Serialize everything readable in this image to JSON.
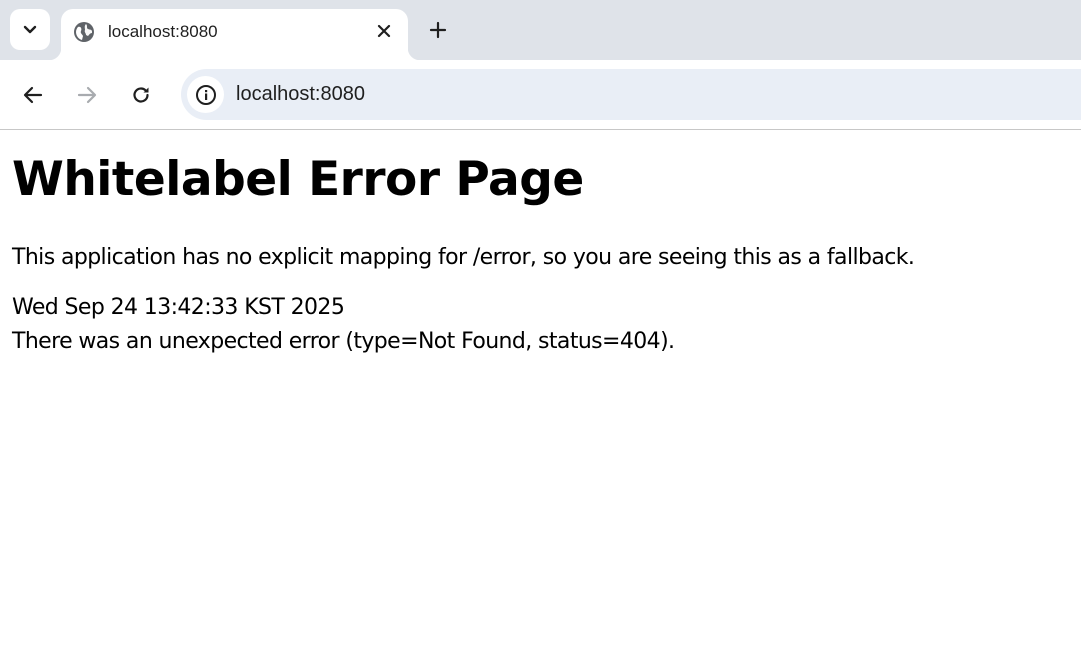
{
  "browser": {
    "tab": {
      "title": "localhost:8080",
      "favicon": "globe-icon"
    },
    "toolbar": {
      "back_icon": "arrow-left-icon",
      "forward_icon": "arrow-right-icon",
      "reload_icon": "reload-icon",
      "site_info_icon": "info-icon",
      "address": "localhost:8080"
    },
    "colors": {
      "tabstrip": "#dfe3e9",
      "omnibox": "#e9eef6",
      "forward_disabled": "#a8abaf"
    }
  },
  "page": {
    "heading": "Whitelabel Error Page",
    "message": "This application has no explicit mapping for /error, so you are seeing this as a fallback.",
    "timestamp": "Wed Sep 24 13:42:33 KST 2025",
    "error": "There was an unexpected error (type=Not Found, status=404)."
  }
}
